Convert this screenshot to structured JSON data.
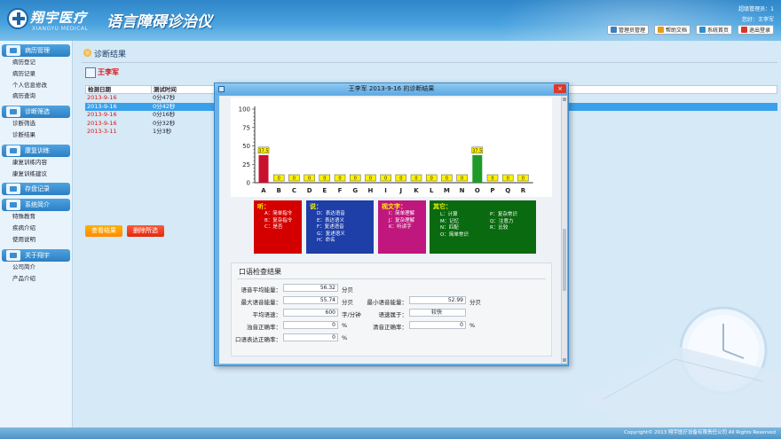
{
  "header": {
    "brand": "翔宇医疗",
    "brand_sub": "XIANGYU MEDICAL",
    "app_title": "语言障碍诊治仪",
    "user_line1": "超级管理员：1",
    "user_line2": "您好：王李军",
    "buttons": [
      "管理员管理",
      "帮助文档",
      "系统首页",
      "退出登录"
    ]
  },
  "sidebar": {
    "sections": [
      {
        "label": "病历管理",
        "items": [
          "病历登记",
          "病历记录",
          "个人信息修改",
          "病历查询"
        ]
      },
      {
        "label": "诊断筛选",
        "items": [
          "诊断筛选",
          "诊断结果"
        ]
      },
      {
        "label": "康复训练",
        "items": [
          "康复训练内容",
          "康复训练建议"
        ]
      },
      {
        "label": "存盘记录",
        "items": []
      },
      {
        "label": "系统简介",
        "items": [
          "特殊教育",
          "疾病介绍",
          "使用说明"
        ]
      },
      {
        "label": "关于翔宇",
        "items": [
          "公司简介",
          "产品介绍"
        ]
      }
    ]
  },
  "main": {
    "page_title": "诊断结果",
    "patient_name": "王李军",
    "table": {
      "headers": [
        "检测日期",
        "测试时间"
      ],
      "rows": [
        {
          "date": "2013-9-16",
          "time": "0分47秒"
        },
        {
          "date": "2013-9-16",
          "time": "0分42秒"
        },
        {
          "date": "2013-9-16",
          "time": "0分16秒"
        },
        {
          "date": "2013-9-16",
          "time": "0分32秒"
        },
        {
          "date": "2013-3-11",
          "time": "1分3秒"
        }
      ]
    },
    "view_button": "查看结果",
    "delete_button": "删除所选"
  },
  "modal": {
    "title": "王李军 2013-9-16 的诊断结果",
    "close_label": "×",
    "legend": {
      "ting": {
        "title": "听：",
        "items": [
          "A：简单指令",
          "B：复杂指令",
          "C：是否"
        ]
      },
      "shuo": {
        "title": "说：",
        "items": [
          "D：表达语音",
          "E：表达语义",
          "F：复述语音",
          "G：复述语义",
          "H：命名"
        ]
      },
      "wenzi": {
        "title": "视文字：",
        "items": [
          "I：简单理解",
          "J：复杂理解",
          "K：听读字"
        ]
      },
      "qita": {
        "title": "其它：",
        "col1": [
          "L：计算",
          "M：记忆",
          "N：匹配",
          "O：简单常识"
        ],
        "col2": [
          "P：复杂常识",
          "Q：注意力",
          "R：比较"
        ]
      }
    },
    "oral": {
      "title": "口语检查结果",
      "avg_energy_label": "语音平均能量：",
      "avg_energy": "56.32",
      "avg_energy_unit": "分贝",
      "max_energy_label": "最大语音能量：",
      "max_energy": "55.74",
      "max_energy_unit": "分贝",
      "min_energy_label": "最小语音能量：",
      "min_energy": "52.99",
      "min_energy_unit": "分贝",
      "speed_label": "平均语速：",
      "speed": "600",
      "speed_unit": "字/分钟",
      "speed_type_label": "语速属于：",
      "speed_type": "较快",
      "voiced_label": "浊音正确率：",
      "voiced": "0",
      "voiced_unit": "%",
      "unvoiced_label": "清音正确率：",
      "unvoiced": "0",
      "unvoiced_unit": "%",
      "expr_label": "口语表达正确率：",
      "expr": "0",
      "expr_unit": "%"
    }
  },
  "chart_data": {
    "type": "bar",
    "categories": [
      "A",
      "B",
      "C",
      "D",
      "E",
      "F",
      "G",
      "H",
      "I",
      "J",
      "K",
      "L",
      "M",
      "N",
      "O",
      "P",
      "Q",
      "R"
    ],
    "values": [
      37.5,
      0,
      0,
      0,
      0,
      0,
      0,
      0,
      0,
      0,
      0,
      0,
      0,
      0,
      37.5,
      0,
      0,
      0
    ],
    "value_labels": [
      "37.5",
      "0",
      "0",
      "0",
      "0",
      "0",
      "0",
      "0",
      "0",
      "0",
      "0",
      "0",
      "0",
      "0",
      "37.5",
      "0",
      "0",
      "0"
    ],
    "bar_colors": {
      "A": "#c8102e",
      "O": "#1f9a2a"
    },
    "y_ticks": [
      "0",
      "25",
      "50",
      "75",
      "100"
    ],
    "ylim": [
      0,
      100
    ],
    "grid": false
  },
  "footer": {
    "copyright": "Copyright© 2013 翔宇医疗设备有限责任公司 All Rights Reserved"
  }
}
